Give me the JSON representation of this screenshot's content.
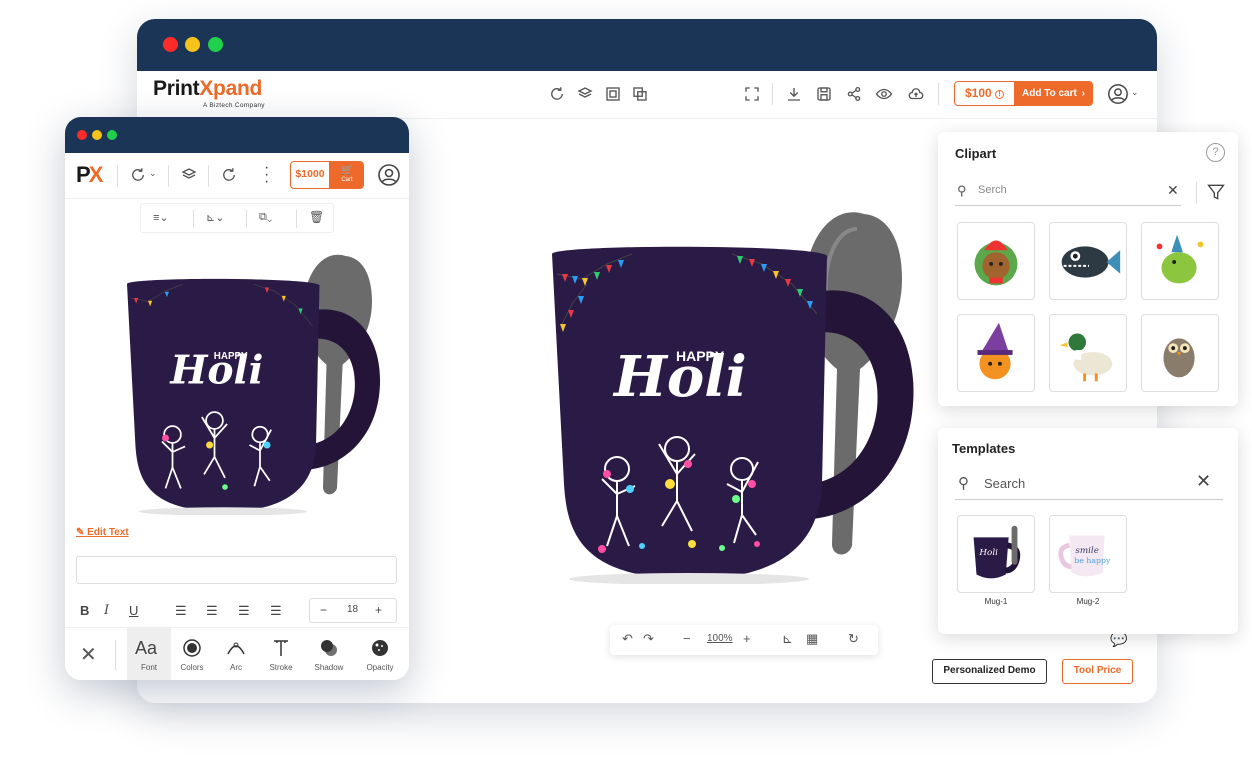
{
  "desktop": {
    "logo_primary": "Print",
    "logo_accent": "Xpand",
    "logo_tagline": "A Biztech Company",
    "price": "$100",
    "add_to_cart": "Add To cart",
    "zoom_level": "100%",
    "personalized_demo": "Personalized Demo",
    "tool_price": "Tool Price"
  },
  "clipart": {
    "title": "Clipart",
    "search_placeholder": "Serch",
    "items": [
      "teddy-bear",
      "piranha-fish",
      "dinosaur-party",
      "pumpkin-witch",
      "duck",
      "owl"
    ]
  },
  "templates": {
    "title": "Templates",
    "search_placeholder": "Search",
    "items": [
      {
        "label": "Mug-1"
      },
      {
        "label": "Mug-2"
      }
    ]
  },
  "mug_design": {
    "line1": "HAPPY",
    "line2": "Holi"
  },
  "mug2_design": {
    "line1": "smile",
    "line2": "be happy"
  },
  "mobile": {
    "logo": "PX",
    "price": "$1000",
    "cart_label": "Cart",
    "edit_text": "Edit Text",
    "font_size": "18",
    "tools": [
      {
        "label": "Font"
      },
      {
        "label": "Colors"
      },
      {
        "label": "Arc"
      },
      {
        "label": "Stroke"
      },
      {
        "label": "Shadow"
      },
      {
        "label": "Opacity"
      }
    ]
  },
  "colors": {
    "accent": "#ee6a2a",
    "titlebar": "#1b3556",
    "mug": "#2a1a46",
    "spoon": "#6b6b6b"
  }
}
